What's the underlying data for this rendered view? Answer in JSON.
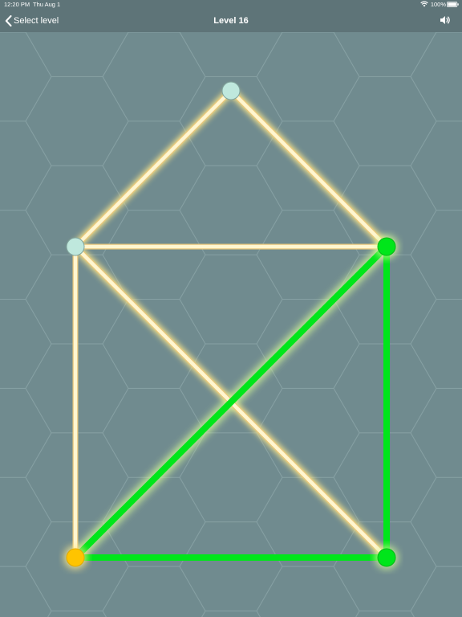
{
  "status_bar": {
    "time": "12:20 PM",
    "date": "Thu Aug 1",
    "battery": "100%",
    "wifi_icon": "wifi-icon",
    "battery_icon": "battery-full-icon"
  },
  "nav": {
    "back_label": "Select level",
    "back_icon": "chevron-left-icon",
    "title": "Level 16",
    "sound_icon": "speaker-icon"
  },
  "puzzle": {
    "colors": {
      "background": "#708b8f",
      "hex_grid": "#86a0a3",
      "untraced_line": "#fff6d0",
      "untraced_glow": "#ffe98a",
      "traced_line": "#00e61a",
      "traced_glow": "#d9ff9a",
      "vertex_default": "#bfe8dd",
      "vertex_traced": "#00e61a",
      "vertex_current": "#ffc400"
    },
    "vertices": [
      {
        "id": "apex",
        "state": "default"
      },
      {
        "id": "upper-left",
        "state": "default"
      },
      {
        "id": "upper-right",
        "state": "traced"
      },
      {
        "id": "lower-left",
        "state": "current"
      },
      {
        "id": "lower-right",
        "state": "traced"
      }
    ],
    "edges": [
      {
        "from": "apex",
        "to": "upper-left",
        "traced": false
      },
      {
        "from": "apex",
        "to": "upper-right",
        "traced": false
      },
      {
        "from": "upper-left",
        "to": "upper-right",
        "traced": false
      },
      {
        "from": "upper-left",
        "to": "lower-left",
        "traced": false
      },
      {
        "from": "upper-left",
        "to": "lower-right",
        "traced": false
      },
      {
        "from": "lower-left",
        "to": "upper-right",
        "traced": true
      },
      {
        "from": "upper-right",
        "to": "lower-right",
        "traced": true
      },
      {
        "from": "lower-left",
        "to": "lower-right",
        "traced": true
      }
    ]
  }
}
